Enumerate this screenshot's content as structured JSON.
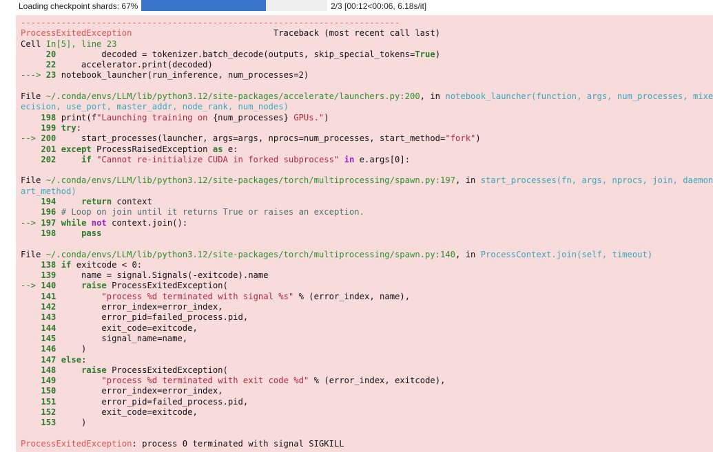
{
  "progress": {
    "label": "Loading checkpoint shards: 67%",
    "fraction": 0.67,
    "stats": "2/3 [00:12<00:06, 6.18s/it]",
    "fill_color": "#3874cc"
  },
  "traceback": {
    "background": "#f8dcdc",
    "divider": "---------------------------------------------------------------------------",
    "exception_name": "ProcessExitedException",
    "header_right": "Traceback (most recent call last)",
    "cell": {
      "prefix": "Cell ",
      "location": "In[5], line 23",
      "lines": [
        {
          "gutter": "     20 ",
          "code": "        decoded = tokenizer.batch_decode(outputs, skip_special_tokens=True)"
        },
        {
          "gutter": "     22 ",
          "code": "    accelerator.print(decoded)"
        },
        {
          "gutter": "---> 23 ",
          "code": "notebook_launcher(run_inference, num_processes=2)"
        }
      ]
    },
    "frames": [
      {
        "file_prefix": "File ",
        "path": "~/.conda/envs/LLM/lib/python3.12/site-packages/accelerate/launchers.py:200",
        "in_text": ", in ",
        "func_line1": "notebook_launcher(function, args, num_processes, mixed_pr",
        "func_line2": "ecision, use_port, master_addr, node_rank, num_nodes)",
        "lines": [
          {
            "gutter": "    198 ",
            "code": "print(f\"Launching training on {num_processes} GPUs.\")"
          },
          {
            "gutter": "    199 ",
            "code": "try:"
          },
          {
            "gutter": "--> 200 ",
            "code": "    start_processes(launcher, args=args, nprocs=num_processes, start_method=\"fork\")"
          },
          {
            "gutter": "    201 ",
            "code": "except ProcessRaisedException as e:"
          },
          {
            "gutter": "    202 ",
            "code": "    if \"Cannot re-initialize CUDA in forked subprocess\" in e.args[0]:"
          }
        ]
      },
      {
        "file_prefix": "File ",
        "path": "~/.conda/envs/LLM/lib/python3.12/site-packages/torch/multiprocessing/spawn.py:197",
        "in_text": ", in ",
        "func_line1": "start_processes(fn, args, nprocs, join, daemon, st",
        "func_line2": "art_method)",
        "lines": [
          {
            "gutter": "    194 ",
            "code": "    return context"
          },
          {
            "gutter": "    196 ",
            "code": "# Loop on join until it returns True or raises an exception."
          },
          {
            "gutter": "--> 197 ",
            "code": "while not context.join():"
          },
          {
            "gutter": "    198 ",
            "code": "    pass"
          }
        ]
      },
      {
        "file_prefix": "File ",
        "path": "~/.conda/envs/LLM/lib/python3.12/site-packages/torch/multiprocessing/spawn.py:140",
        "in_text": ", in ",
        "func_line1": "ProcessContext.join(self, timeout)",
        "func_line2": "",
        "lines": [
          {
            "gutter": "    138 ",
            "code": "if exitcode < 0:"
          },
          {
            "gutter": "    139 ",
            "code": "    name = signal.Signals(-exitcode).name"
          },
          {
            "gutter": "--> 140 ",
            "code": "    raise ProcessExitedException("
          },
          {
            "gutter": "    141 ",
            "code": "        \"process %d terminated with signal %s\" % (error_index, name),"
          },
          {
            "gutter": "    142 ",
            "code": "        error_index=error_index,"
          },
          {
            "gutter": "    143 ",
            "code": "        error_pid=failed_process.pid,"
          },
          {
            "gutter": "    144 ",
            "code": "        exit_code=exitcode,"
          },
          {
            "gutter": "    145 ",
            "code": "        signal_name=name,"
          },
          {
            "gutter": "    146 ",
            "code": "    )"
          },
          {
            "gutter": "    147 ",
            "code": "else:"
          },
          {
            "gutter": "    148 ",
            "code": "    raise ProcessExitedException("
          },
          {
            "gutter": "    149 ",
            "code": "        \"process %d terminated with exit code %d\" % (error_index, exitcode),"
          },
          {
            "gutter": "    150 ",
            "code": "        error_index=error_index,"
          },
          {
            "gutter": "    151 ",
            "code": "        error_pid=failed_process.pid,"
          },
          {
            "gutter": "    152 ",
            "code": "        exit_code=exitcode,"
          },
          {
            "gutter": "    153 ",
            "code": "    )"
          }
        ]
      }
    ],
    "final_error": {
      "name": "ProcessExitedException",
      "message": ": process 0 terminated with signal SIGKILL"
    }
  }
}
